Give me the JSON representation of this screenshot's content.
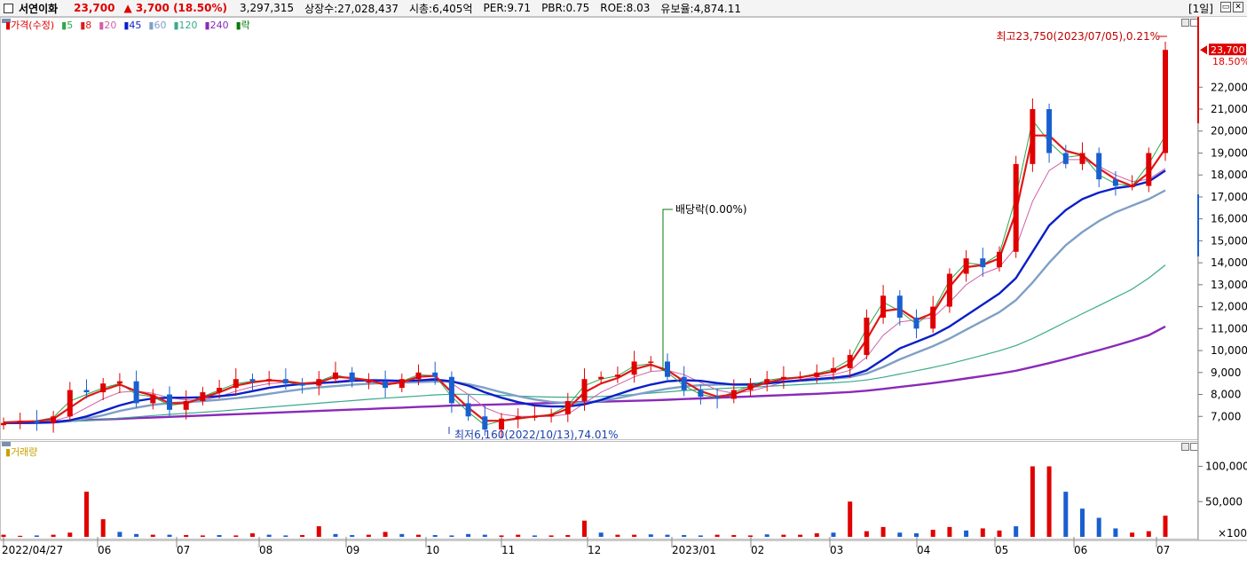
{
  "header": {
    "stock_name": "서연이화",
    "price": "23,700",
    "change_arrow": "▲",
    "change": "3,700",
    "change_pct": "(18.50%)",
    "volume": "3,297,315",
    "listed_shares": "상장수:27,028,437",
    "market_cap": "시총:6,405억",
    "per": "PER:9.71",
    "pbr": "PBR:0.75",
    "roe": "ROE:8.03",
    "retention": "유보율:4,874.11",
    "period": "[1일]"
  },
  "price_legend": {
    "price_label": "가격(수정)",
    "ma5": "5",
    "ma8": "8",
    "ma20": "20",
    "ma45": "45",
    "ma60": "60",
    "ma120": "120",
    "ma240": "240",
    "ex_label": "락"
  },
  "volume_legend": {
    "label": "거래량"
  },
  "annotations": {
    "high": "최고23,750(2023/07/05),0.21%",
    "low": "최저6,160(2022/10/13),74.01%",
    "dividend": "배당락(0.00%)",
    "current_price_tag": "23,700",
    "current_pct_tag": "18.50%"
  },
  "colors": {
    "up": "#e00000",
    "down": "#1a5fd0",
    "ma5": "#2ea84a",
    "ma8": "#e01818",
    "ma20": "#d060a8",
    "ma45": "#0a1fc8",
    "ma60": "#7f9fc6",
    "ma120": "#3aaa8c",
    "ma240": "#8a2ab8"
  },
  "chart_data": [
    {
      "type": "line",
      "title": "가격(수정)",
      "x": [
        "2022/04/27",
        "06",
        "07",
        "08",
        "09",
        "10",
        "11",
        "12",
        "2023/01",
        "02",
        "03",
        "04",
        "05",
        "06",
        "07"
      ],
      "y_ticks": [
        7000,
        8000,
        9000,
        10000,
        11000,
        12000,
        13000,
        14000,
        15000,
        16000,
        17000,
        18000,
        19000,
        20000,
        21000,
        22000
      ],
      "ylim": [
        6000,
        24800
      ],
      "close_approx": [
        6700,
        6800,
        6700,
        7000,
        8200,
        8100,
        8500,
        8600,
        7600,
        8000,
        7300,
        7700,
        8100,
        8300,
        8700,
        8600,
        8700,
        8500,
        8400,
        8700,
        9000,
        8600,
        8600,
        8300,
        8700,
        9000,
        8800,
        7600,
        7000,
        6400,
        6900,
        7000,
        7000,
        7100,
        7700,
        8700,
        8800,
        8900,
        9500,
        9500,
        8800,
        8200,
        7900,
        7800,
        8200,
        8500,
        8700,
        8800,
        8800,
        9000,
        9200,
        9800,
        11500,
        12500,
        11500,
        11000,
        12000,
        13500,
        14200,
        13800,
        14500,
        18500,
        21000,
        19000,
        18500,
        19000,
        17800,
        17500,
        17500,
        19000,
        23700
      ],
      "series": [
        {
          "name": "5",
          "values": [
            6750,
            6780,
            6800,
            6950,
            7700,
            8000,
            8300,
            8500,
            8000,
            7900,
            7500,
            7600,
            7900,
            8200,
            8500,
            8600,
            8650,
            8550,
            8450,
            8600,
            8900,
            8700,
            8650,
            8400,
            8600,
            8900,
            8850,
            7900,
            7200,
            6600,
            6800,
            6950,
            7000,
            7100,
            7500,
            8400,
            8700,
            8850,
            9300,
            9400,
            9000,
            8400,
            8000,
            7850,
            8100,
            8400,
            8650,
            8750,
            8800,
            8950,
            9150,
            9600,
            11000,
            12200,
            11800,
            11200,
            11800,
            13200,
            14000,
            13900,
            14400,
            17000,
            20500,
            19500,
            18800,
            18900,
            18000,
            17600,
            17500,
            18500,
            19800
          ]
        },
        {
          "name": "8",
          "values": [
            6720,
            6760,
            6780,
            6880,
            7400,
            7900,
            8200,
            8450,
            8150,
            7950,
            7600,
            7600,
            7850,
            8100,
            8400,
            8550,
            8650,
            8600,
            8500,
            8550,
            8800,
            8750,
            8650,
            8450,
            8550,
            8800,
            8850,
            8100,
            7400,
            6800,
            6800,
            6900,
            7000,
            7050,
            7350,
            8100,
            8500,
            8750,
            9150,
            9350,
            9100,
            8600,
            8150,
            7900,
            8000,
            8300,
            8550,
            8700,
            8780,
            8900,
            9050,
            9400,
            10500,
            11800,
            11900,
            11400,
            11700,
            12900,
            13800,
            13900,
            14200,
            16300,
            19800,
            19800,
            19100,
            18900,
            18300,
            17800,
            17500,
            18100,
            19200
          ]
        },
        {
          "name": "20",
          "values": [
            6700,
            6720,
            6740,
            6800,
            7000,
            7400,
            7800,
            8100,
            8150,
            8050,
            7850,
            7750,
            7750,
            7900,
            8150,
            8350,
            8500,
            8550,
            8520,
            8500,
            8600,
            8680,
            8660,
            8560,
            8550,
            8650,
            8750,
            8500,
            8000,
            7400,
            7100,
            7000,
            7000,
            7000,
            7100,
            7600,
            8100,
            8450,
            8800,
            9050,
            9100,
            8900,
            8550,
            8200,
            8050,
            8150,
            8350,
            8550,
            8680,
            8800,
            8900,
            9100,
            9700,
            10700,
            11300,
            11400,
            11500,
            12200,
            13000,
            13500,
            13800,
            14700,
            16800,
            18200,
            18700,
            18700,
            18400,
            18000,
            17700,
            17800,
            18300
          ]
        },
        {
          "name": "45",
          "values": [
            6700,
            6700,
            6710,
            6730,
            6820,
            7000,
            7250,
            7500,
            7700,
            7820,
            7850,
            7850,
            7870,
            7920,
            8000,
            8150,
            8300,
            8400,
            8480,
            8520,
            8560,
            8620,
            8650,
            8640,
            8620,
            8640,
            8680,
            8600,
            8400,
            8100,
            7850,
            7650,
            7500,
            7450,
            7450,
            7550,
            7750,
            8000,
            8250,
            8450,
            8600,
            8650,
            8620,
            8520,
            8450,
            8450,
            8500,
            8580,
            8640,
            8700,
            8760,
            8850,
            9100,
            9600,
            10100,
            10400,
            10700,
            11100,
            11600,
            12100,
            12600,
            13300,
            14500,
            15700,
            16400,
            16900,
            17200,
            17400,
            17500,
            17700,
            18200
          ]
        },
        {
          "name": "60",
          "values": [
            6700,
            6700,
            6700,
            6720,
            6780,
            6900,
            7050,
            7250,
            7400,
            7530,
            7600,
            7650,
            7700,
            7760,
            7830,
            7920,
            8030,
            8140,
            8240,
            8320,
            8380,
            8440,
            8490,
            8520,
            8540,
            8560,
            8590,
            8580,
            8470,
            8300,
            8100,
            7920,
            7770,
            7660,
            7600,
            7620,
            7700,
            7830,
            7980,
            8130,
            8260,
            8360,
            8420,
            8450,
            8460,
            8480,
            8520,
            8570,
            8620,
            8670,
            8720,
            8790,
            8950,
            9250,
            9600,
            9900,
            10200,
            10550,
            10950,
            11350,
            11750,
            12300,
            13100,
            14000,
            14800,
            15400,
            15900,
            16300,
            16600,
            16900,
            17300
          ]
        },
        {
          "name": "120",
          "values": [
            6700,
            6710,
            6720,
            6740,
            6770,
            6810,
            6860,
            6920,
            6980,
            7040,
            7090,
            7140,
            7190,
            7240,
            7300,
            7360,
            7420,
            7480,
            7540,
            7600,
            7660,
            7720,
            7780,
            7830,
            7880,
            7930,
            7980,
            8010,
            8010,
            7990,
            7960,
            7930,
            7900,
            7880,
            7870,
            7880,
            7910,
            7950,
            8000,
            8060,
            8120,
            8180,
            8220,
            8260,
            8300,
            8330,
            8370,
            8410,
            8450,
            8490,
            8530,
            8580,
            8660,
            8780,
            8930,
            9080,
            9230,
            9400,
            9590,
            9790,
            9990,
            10230,
            10550,
            10920,
            11300,
            11680,
            12050,
            12420,
            12800,
            13300,
            13900
          ]
        },
        {
          "name": "240",
          "values": [
            6700,
            6720,
            6740,
            6770,
            6800,
            6830,
            6860,
            6890,
            6920,
            6950,
            6980,
            7010,
            7040,
            7070,
            7100,
            7130,
            7160,
            7190,
            7220,
            7250,
            7280,
            7310,
            7340,
            7370,
            7400,
            7430,
            7460,
            7490,
            7510,
            7530,
            7550,
            7570,
            7590,
            7610,
            7630,
            7650,
            7670,
            7690,
            7710,
            7730,
            7760,
            7790,
            7820,
            7850,
            7880,
            7910,
            7940,
            7970,
            8000,
            8030,
            8070,
            8110,
            8170,
            8250,
            8340,
            8430,
            8520,
            8620,
            8730,
            8840,
            8950,
            9080,
            9250,
            9430,
            9620,
            9820,
            10020,
            10230,
            10450,
            10700,
            11100
          ]
        }
      ]
    },
    {
      "type": "bar",
      "title": "거래량",
      "unit": "×100",
      "y_ticks": [
        50000,
        100000
      ],
      "ylim": [
        0,
        112000
      ],
      "values": [
        3000,
        1500,
        2000,
        3000,
        6000,
        64000,
        25000,
        7000,
        4000,
        3000,
        3000,
        2500,
        2000,
        2500,
        2000,
        5000,
        3000,
        2000,
        2500,
        15000,
        4000,
        2500,
        3000,
        7000,
        4000,
        3000,
        2500,
        2000,
        4000,
        3000,
        2000,
        3000,
        2000,
        2000,
        2500,
        23000,
        6000,
        3000,
        3000,
        3500,
        3000,
        2500,
        2000,
        3000,
        2500,
        2000,
        3500,
        3000,
        3000,
        5000,
        6000,
        50000,
        8000,
        14000,
        6000,
        5000,
        10000,
        14000,
        9000,
        12000,
        9000,
        15000,
        100000,
        100000,
        64000,
        40000,
        27000,
        12000,
        6000,
        8000,
        30000
      ],
      "colors": [
        "up",
        "up",
        "down",
        "up",
        "up",
        "up",
        "up",
        "down",
        "down",
        "up",
        "down",
        "up",
        "up",
        "down",
        "up",
        "up",
        "down",
        "down",
        "up",
        "up",
        "down",
        "down",
        "up",
        "up",
        "down",
        "up",
        "down",
        "down",
        "down",
        "down",
        "up",
        "up",
        "down",
        "up",
        "up",
        "up",
        "down",
        "up",
        "up",
        "down",
        "down",
        "down",
        "down",
        "up",
        "up",
        "up",
        "down",
        "up",
        "up",
        "up",
        "down",
        "up",
        "up",
        "up",
        "down",
        "down",
        "up",
        "up",
        "down",
        "up",
        "up",
        "down",
        "up",
        "up",
        "down",
        "down",
        "down",
        "down",
        "up",
        "up",
        "up"
      ]
    }
  ]
}
